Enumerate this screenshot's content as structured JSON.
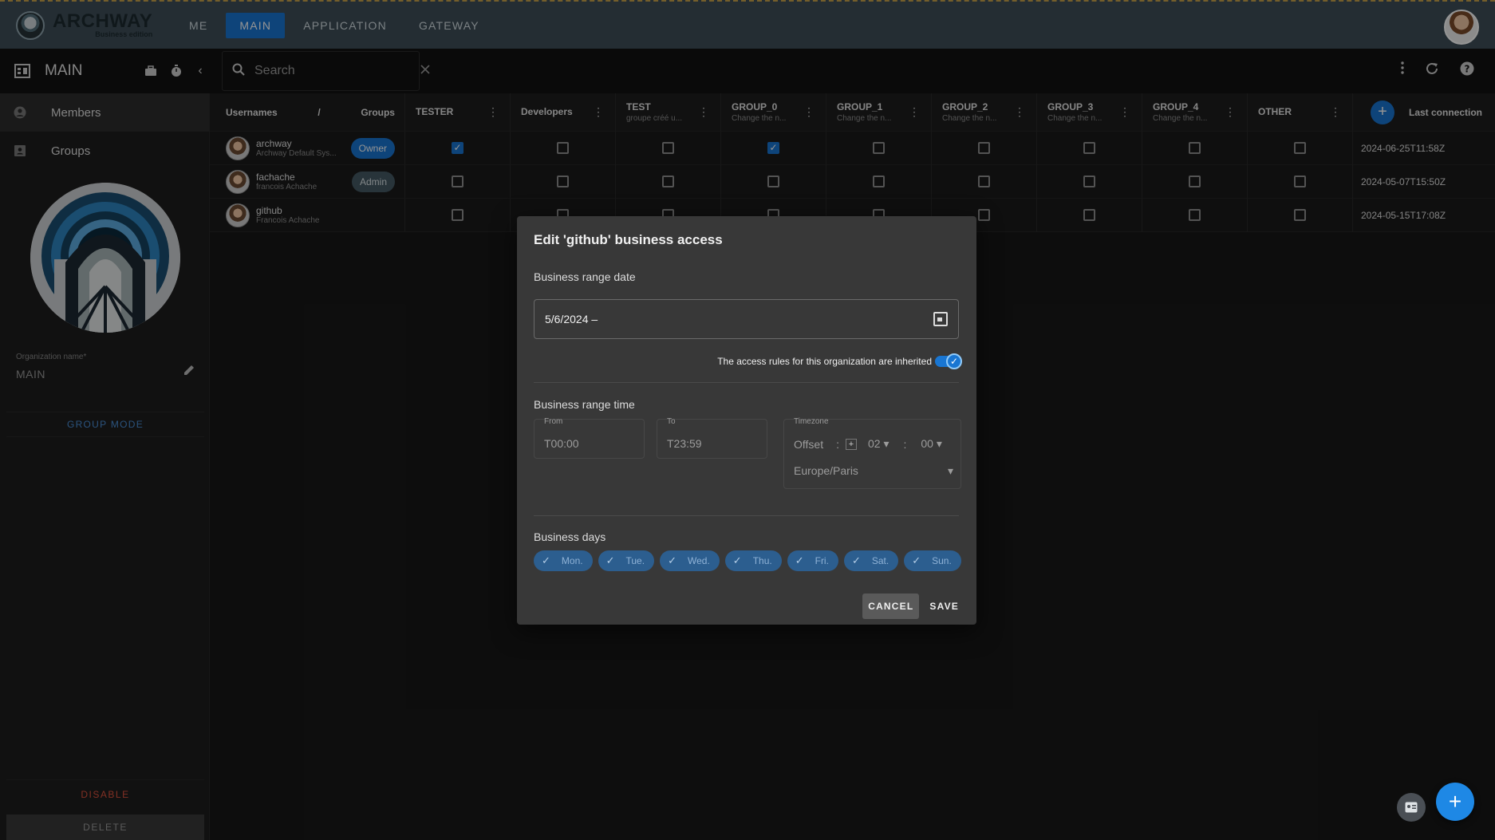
{
  "app": {
    "brand_name": "ARCHWAY",
    "brand_edition": "Business edition",
    "nav": [
      {
        "label": "ME"
      },
      {
        "label": "MAIN"
      },
      {
        "label": "APPLICATION"
      },
      {
        "label": "GATEWAY"
      }
    ],
    "active_nav": "MAIN"
  },
  "subbar": {
    "title": "MAIN",
    "search_placeholder": "Search"
  },
  "sidebar": {
    "items": [
      {
        "label": "Members"
      },
      {
        "label": "Groups"
      }
    ],
    "org_field_label": "Organization name*",
    "org_field_value": "MAIN",
    "group_mode_label": "GROUP MODE",
    "disable_label": "DISABLE",
    "delete_label": "DELETE"
  },
  "table": {
    "header_users": "Usernames",
    "header_sep": "/",
    "header_groups": "Groups",
    "columns": [
      {
        "name": "TESTER",
        "sub": ""
      },
      {
        "name": "Developers",
        "sub": ""
      },
      {
        "name": "TEST",
        "sub": "groupe créé u..."
      },
      {
        "name": "GROUP_0",
        "sub": "Change the n..."
      },
      {
        "name": "GROUP_1",
        "sub": "Change the n..."
      },
      {
        "name": "GROUP_2",
        "sub": "Change the n..."
      },
      {
        "name": "GROUP_3",
        "sub": "Change the n..."
      },
      {
        "name": "GROUP_4",
        "sub": "Change the n..."
      },
      {
        "name": "OTHER",
        "sub": ""
      }
    ],
    "last_connection_label": "Last connection",
    "rows": [
      {
        "name": "archway",
        "sub": "Archway Default Sys...",
        "role": "Owner",
        "checks": [
          true,
          false,
          false,
          true,
          false,
          false,
          false,
          false,
          false
        ],
        "last": "2024-06-25T11:58Z"
      },
      {
        "name": "fachache",
        "sub": "francois Achache",
        "role": "Admin",
        "checks": [
          false,
          false,
          false,
          false,
          false,
          false,
          false,
          false,
          false
        ],
        "last": "2024-05-07T15:50Z"
      },
      {
        "name": "github",
        "sub": "Francois Achache",
        "role": "",
        "checks": [
          false,
          false,
          false,
          false,
          false,
          false,
          false,
          false,
          false
        ],
        "last": "2024-05-15T17:08Z"
      }
    ]
  },
  "dialog": {
    "title": "Edit 'github' business access",
    "range_date_label": "Business range date",
    "date_value": "5/6/2024 –",
    "inherit_label": "The access rules for this organization are inherited",
    "inherited": true,
    "range_time_label": "Business range time",
    "from_label": "From",
    "from_value": "T00:00",
    "to_label": "To",
    "to_value": "T23:59",
    "timezone_label": "Timezone",
    "offset_label": "Offset",
    "offset_colon": ":",
    "offset_sign": "+",
    "offset_hours": "02",
    "offset_minutes": "00",
    "zone": "Europe/Paris",
    "days_label": "Business days",
    "days": [
      "Mon.",
      "Tue.",
      "Wed.",
      "Thu.",
      "Fri.",
      "Sat.",
      "Sun."
    ],
    "cancel_label": "CANCEL",
    "save_label": "SAVE"
  },
  "colors": {
    "accent": "#1976d2",
    "topbar": "#3e4f59",
    "danger": "#e0533e"
  }
}
